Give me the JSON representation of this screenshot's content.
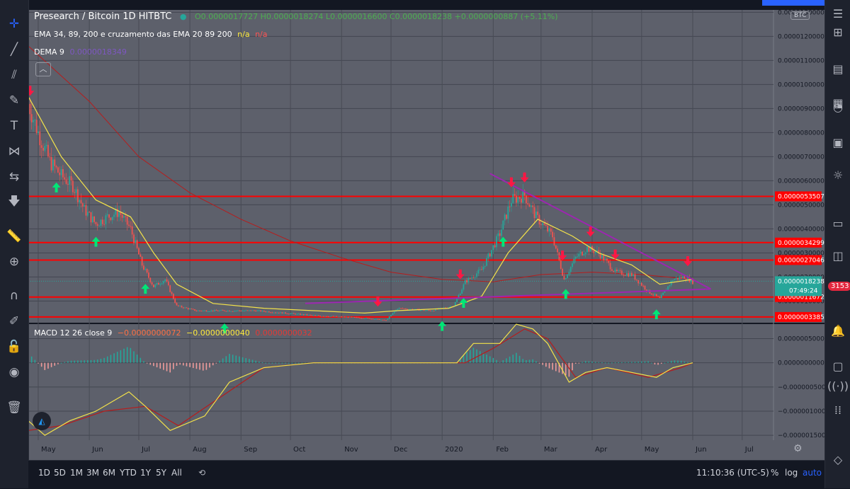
{
  "header": {
    "symbol": "Presearch / Bitcoin  1D  HITBTC",
    "ohlc": "O0.0000017727  H0.0000018274  L0.0000016600  C0.0000018238  +0.0000000887 (+5.11%)",
    "ema_label": "EMA 34, 89, 200 e cruzamento das EMA  20 89 200",
    "ema_na_1": "n/a",
    "ema_na_2": "n/a",
    "dema_label": "DEMA 9",
    "dema_value": "0.0000018349",
    "currency_badge": "BTC"
  },
  "macd": {
    "label": "MACD 12 26 close 9",
    "v1": "−0.0000000072",
    "v2": "−0.0000000040",
    "v3": "0.0000000032"
  },
  "price_axis": {
    "ticks": [
      "0.0000130000",
      "0.0000120000",
      "0.0000110000",
      "0.0000100000",
      "0.0000090000",
      "0.0000080000",
      "0.0000070000",
      "0.0000060000",
      "0.0000050000",
      "0.0000040000",
      "0.0000030000",
      "0.0000020000",
      "0.0000010000"
    ],
    "levels": [
      "0.0000053507",
      "0.0000034299",
      "0.0000027046",
      "0.0000011672",
      "0.0000003385"
    ],
    "current_price": "0.0000018238",
    "countdown": "07:49:24"
  },
  "macd_axis": {
    "ticks": [
      "0.0000005000",
      "0.0000000000",
      "−0.0000005000",
      "−0.0000010000",
      "−0.0000015000"
    ]
  },
  "time_axis": [
    "May",
    "Jun",
    "Jul",
    "Aug",
    "Sep",
    "Oct",
    "Nov",
    "Dec",
    "2020",
    "Feb",
    "Mar",
    "Apr",
    "May",
    "Jun",
    "Jul"
  ],
  "bottom_bar": {
    "ranges": [
      "1D",
      "5D",
      "1M",
      "3M",
      "6M",
      "YTD",
      "1Y",
      "5Y",
      "All"
    ],
    "clock": "11:10:36 (UTC-5)",
    "percent": "%",
    "log": "log",
    "auto": "auto"
  },
  "notifications_badge": "3153",
  "colors": {
    "bg": "#131722",
    "pane": "#5d606b",
    "up": "#26a69a",
    "down": "#ef5350",
    "level": "#ff0000",
    "trend": "#9c27b0",
    "ema": "#f3e24a",
    "ema_slow": "#b71c1c",
    "macd_line": "#f3e24a",
    "signal_line": "#b71c1c",
    "arrow_up": "#00e676",
    "arrow_down": "#ff1744"
  },
  "chart_data": {
    "type": "candlestick",
    "price_ylim": [
      1e-07,
      1.31e-05
    ],
    "levels": [
      5.3507e-06,
      3.4299e-06,
      2.7046e-06,
      1.1672e-06,
      3.385e-07
    ],
    "price_path": [
      [
        "2019-04-25",
        9.2e-06
      ],
      [
        "2019-05-01",
        8e-06
      ],
      [
        "2019-05-08",
        6.8e-06
      ],
      [
        "2019-05-15",
        6.2e-06
      ],
      [
        "2019-05-22",
        5.8e-06
      ],
      [
        "2019-05-29",
        4.8e-06
      ],
      [
        "2019-06-05",
        4.2e-06
      ],
      [
        "2019-06-12",
        4.5e-06
      ],
      [
        "2019-06-19",
        4.7e-06
      ],
      [
        "2019-06-26",
        4e-06
      ],
      [
        "2019-07-03",
        2.5e-06
      ],
      [
        "2019-07-10",
        1.6e-06
      ],
      [
        "2019-07-17",
        1.9e-06
      ],
      [
        "2019-07-24",
        8e-07
      ],
      [
        "2019-08-05",
        6e-07
      ],
      [
        "2019-08-20",
        6e-07
      ],
      [
        "2019-09-10",
        6e-07
      ],
      [
        "2019-10-15",
        4e-07
      ],
      [
        "2019-11-15",
        3e-07
      ],
      [
        "2019-11-28",
        2e-07
      ],
      [
        "2019-12-05",
        7e-07
      ],
      [
        "2019-12-25",
        6e-07
      ],
      [
        "2020-01-08",
        8e-07
      ],
      [
        "2020-01-15",
        1.8e-06
      ],
      [
        "2020-01-25",
        2.3e-06
      ],
      [
        "2020-02-05",
        3.8e-06
      ],
      [
        "2020-02-12",
        5.2e-06
      ],
      [
        "2020-02-20",
        5.4e-06
      ],
      [
        "2020-02-27",
        4.5e-06
      ],
      [
        "2020-03-08",
        3.7e-06
      ],
      [
        "2020-03-15",
        1.9e-06
      ],
      [
        "2020-03-22",
        2.8e-06
      ],
      [
        "2020-03-29",
        3.2e-06
      ],
      [
        "2020-04-05",
        3e-06
      ],
      [
        "2020-04-15",
        2.2e-06
      ],
      [
        "2020-04-25",
        2.1e-06
      ],
      [
        "2020-05-05",
        1.4e-06
      ],
      [
        "2020-05-12",
        1.1e-06
      ],
      [
        "2020-05-20",
        1.9e-06
      ],
      [
        "2020-05-27",
        2e-06
      ],
      [
        "2020-06-01",
        1.8e-06
      ]
    ],
    "ema_fast": [
      [
        "2019-04-25",
        9.5e-06
      ],
      [
        "2019-05-15",
        7e-06
      ],
      [
        "2019-06-05",
        5.2e-06
      ],
      [
        "2019-06-26",
        4.5e-06
      ],
      [
        "2019-07-10",
        3e-06
      ],
      [
        "2019-07-24",
        1.7e-06
      ],
      [
        "2019-08-15",
        9e-07
      ],
      [
        "2019-09-15",
        7e-07
      ],
      [
        "2019-10-15",
        6e-07
      ],
      [
        "2019-11-15",
        5e-07
      ],
      [
        "2019-12-05",
        6e-07
      ],
      [
        "2020-01-05",
        7e-07
      ],
      [
        "2020-01-25",
        1.2e-06
      ],
      [
        "2020-02-10",
        3e-06
      ],
      [
        "2020-02-28",
        4.4e-06
      ],
      [
        "2020-03-20",
        3.7e-06
      ],
      [
        "2020-04-05",
        3e-06
      ],
      [
        "2020-04-25",
        2.5e-06
      ],
      [
        "2020-05-12",
        1.7e-06
      ],
      [
        "2020-06-01",
        1.9e-06
      ]
    ],
    "ema_slow": [
      [
        "2019-04-25",
        1.16e-05
      ],
      [
        "2019-06-01",
        9.3e-06
      ],
      [
        "2019-07-01",
        7e-06
      ],
      [
        "2019-08-01",
        5.5e-06
      ],
      [
        "2019-09-01",
        4.4e-06
      ],
      [
        "2019-10-01",
        3.5e-06
      ],
      [
        "2019-11-01",
        2.8e-06
      ],
      [
        "2019-12-01",
        2.2e-06
      ],
      [
        "2020-01-01",
        1.9e-06
      ],
      [
        "2020-02-01",
        1.8e-06
      ],
      [
        "2020-03-01",
        2.1e-06
      ],
      [
        "2020-04-01",
        2.2e-06
      ],
      [
        "2020-05-01",
        2.1e-06
      ],
      [
        "2020-06-01",
        1.9e-06
      ]
    ],
    "trendlines": [
      [
        [
          "2020-01-30",
          6.3e-06
        ],
        [
          "2020-06-12",
          1.5e-06
        ]
      ],
      [
        [
          "2019-10-10",
          9e-07
        ],
        [
          "2020-06-12",
          1.5e-06
        ]
      ]
    ],
    "arrows_up": [
      "2019-05-12",
      "2019-06-05",
      "2019-07-05",
      "2019-08-22",
      "2020-01-01",
      "2020-01-14",
      "2020-02-07",
      "2020-03-16",
      "2020-05-10"
    ],
    "arrows_down": [
      "2019-04-26",
      "2019-11-23",
      "2020-01-12",
      "2020-02-12",
      "2020-02-20",
      "2020-03-14",
      "2020-03-31",
      "2020-04-15",
      "2020-05-29"
    ],
    "macd_ylim": [
      -1.6e-06,
      8e-07
    ],
    "macd_line": [
      [
        "2019-04-25",
        -1.2e-06
      ],
      [
        "2019-05-05",
        -1.5e-06
      ],
      [
        "2019-05-20",
        -1.2e-06
      ],
      [
        "2019-06-05",
        -1e-06
      ],
      [
        "2019-06-25",
        -6e-07
      ],
      [
        "2019-07-05",
        -9e-07
      ],
      [
        "2019-07-20",
        -1.4e-06
      ],
      [
        "2019-08-10",
        -1.1e-06
      ],
      [
        "2019-08-25",
        -4e-07
      ],
      [
        "2019-09-15",
        -1e-07
      ],
      [
        "2019-10-15",
        0.0
      ],
      [
        "2019-11-15",
        0.0
      ],
      [
        "2019-12-10",
        0.0
      ],
      [
        "2020-01-10",
        0.0
      ],
      [
        "2020-01-20",
        4e-07
      ],
      [
        "2020-02-05",
        4e-07
      ],
      [
        "2020-02-15",
        8e-07
      ],
      [
        "2020-02-25",
        7e-07
      ],
      [
        "2020-03-05",
        4e-07
      ],
      [
        "2020-03-18",
        -4e-07
      ],
      [
        "2020-03-28",
        -2e-07
      ],
      [
        "2020-04-10",
        -1e-07
      ],
      [
        "2020-04-25",
        -2e-07
      ],
      [
        "2020-05-10",
        -3e-07
      ],
      [
        "2020-05-20",
        -1e-07
      ],
      [
        "2020-06-01",
        0.0
      ]
    ],
    "signal_line": [
      [
        "2019-04-25",
        -1.4e-06
      ],
      [
        "2019-05-15",
        -1.3e-06
      ],
      [
        "2019-06-10",
        -1e-06
      ],
      [
        "2019-07-05",
        -9e-07
      ],
      [
        "2019-07-25",
        -1.3e-06
      ],
      [
        "2019-08-20",
        -7e-07
      ],
      [
        "2019-09-15",
        -1e-07
      ],
      [
        "2019-10-15",
        0.0
      ],
      [
        "2019-11-15",
        0.0
      ],
      [
        "2019-12-10",
        0.0
      ],
      [
        "2020-01-15",
        0.0
      ],
      [
        "2020-02-01",
        3e-07
      ],
      [
        "2020-02-20",
        7e-07
      ],
      [
        "2020-03-05",
        5e-07
      ],
      [
        "2020-03-22",
        -3e-07
      ],
      [
        "2020-04-10",
        -1e-07
      ],
      [
        "2020-05-05",
        -3e-07
      ],
      [
        "2020-05-25",
        -1e-07
      ],
      [
        "2020-06-01",
        0.0
      ]
    ]
  }
}
